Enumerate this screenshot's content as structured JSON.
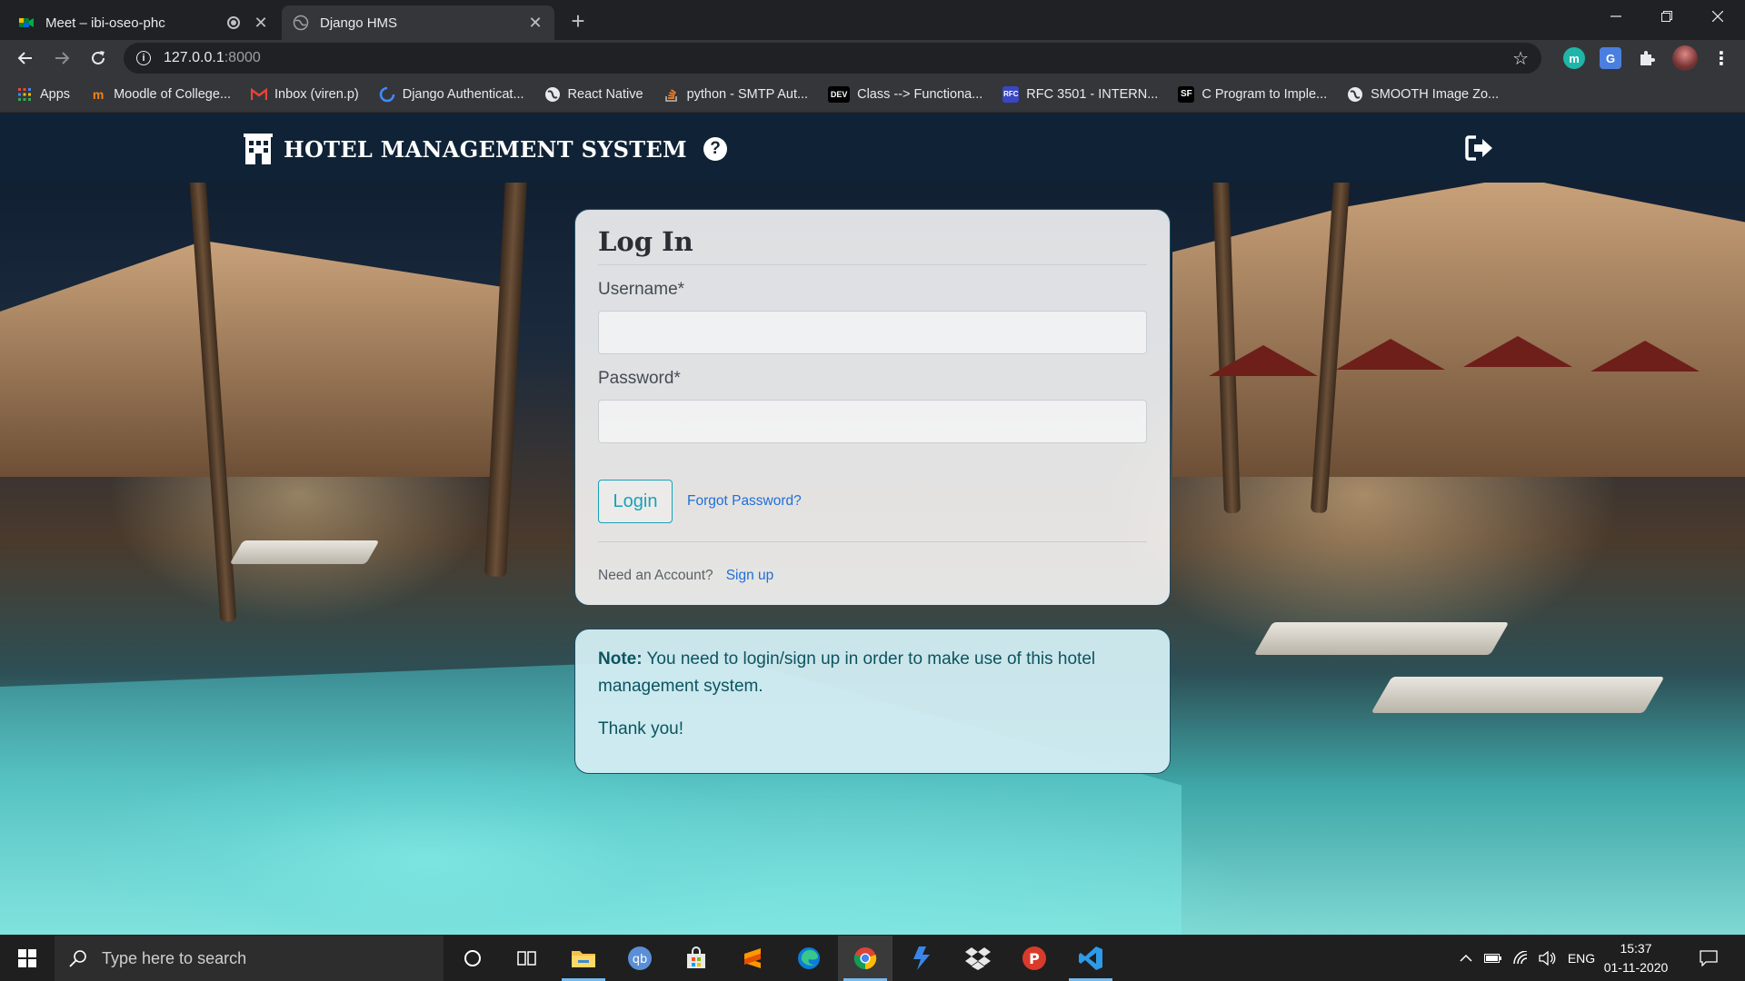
{
  "browser": {
    "tabs": [
      {
        "title": "Meet – ibi-oseo-phc",
        "active": false
      },
      {
        "title": "Django HMS",
        "active": true
      }
    ],
    "url_host": "127.0.0.1",
    "url_port": ":8000",
    "bookmarks": [
      {
        "label": "Apps",
        "icon": "apps-grid-icon"
      },
      {
        "label": "Moodle of College...",
        "icon": "moodle-icon"
      },
      {
        "label": "Inbox (viren.p)",
        "icon": "gmail-icon"
      },
      {
        "label": "Django Authenticat...",
        "icon": "django-icon"
      },
      {
        "label": "React Native",
        "icon": "globe-icon"
      },
      {
        "label": "python - SMTP Aut...",
        "icon": "stackoverflow-icon"
      },
      {
        "label": "Class --> Functiona...",
        "icon": "dev-icon",
        "icon_text": "DEV"
      },
      {
        "label": "RFC 3501 - INTERN...",
        "icon": "rfc-icon",
        "icon_text": "RFC"
      },
      {
        "label": "C Program to Imple...",
        "icon": "sf-icon",
        "icon_text": "SF"
      },
      {
        "label": "SMOOTH Image Zo...",
        "icon": "globe-icon"
      }
    ],
    "extensions": [
      {
        "name": "m-extension-icon",
        "text": "m",
        "color": "#1fb5a8"
      },
      {
        "name": "google-translate-icon",
        "text": "G",
        "color": "#4a7fe0"
      }
    ]
  },
  "app": {
    "brand": "HOTEL MANAGEMENT SYSTEM",
    "colors": {
      "navbar": "#0f2236",
      "accent": "#17a2b8",
      "link": "#1f6fd6",
      "note_bg": "#d1ecf1",
      "note_text": "#0c5460"
    }
  },
  "login": {
    "title": "Log In",
    "username_label": "Username*",
    "username_value": "",
    "username_placeholder": "",
    "password_label": "Password*",
    "password_value": "",
    "password_placeholder": "",
    "login_button": "Login",
    "forgot_link": "Forgot Password?",
    "need_account": "Need an Account?",
    "signup_link": "Sign up"
  },
  "note": {
    "label": "Note:",
    "message": " You need to login/sign up in order to make use of this hotel management system.",
    "thanks": "Thank you!"
  },
  "taskbar": {
    "search_placeholder": "Type here to search",
    "language": "ENG",
    "time": "15:37",
    "date": "01-11-2020"
  }
}
